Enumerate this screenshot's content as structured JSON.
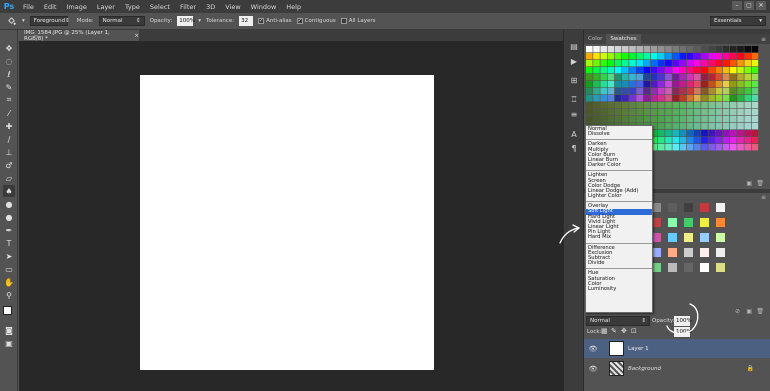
{
  "app": {
    "logo": "Ps"
  },
  "menu": [
    "File",
    "Edit",
    "Image",
    "Layer",
    "Type",
    "Select",
    "Filter",
    "3D",
    "View",
    "Window",
    "Help"
  ],
  "window_controls": [
    "–",
    "▢",
    "✕"
  ],
  "options": {
    "tool_preset_arrow": "▾",
    "fill_source": "Foreground",
    "mode_label": "Mode:",
    "mode_value": "Normal",
    "opacity_label": "Opacity:",
    "opacity_value": "100%",
    "tolerance_label": "Tolerance:",
    "tolerance_value": "32",
    "antialias_label": "Anti-alias",
    "contiguous_label": "Contiguous",
    "all_layers_label": "All Layers",
    "workspace": "Essentials"
  },
  "document": {
    "tab_title": "IMG_1584.JPG @ 25% (Layer 1, RGB/8) *",
    "close_glyph": "×"
  },
  "swatches_panel": {
    "tabs": [
      "Color",
      "Swatches"
    ]
  },
  "layers_panel": {
    "blend_mode": "Normal",
    "opacity_label": "Opacity:",
    "opacity_value": "100%",
    "lock_label": "Lock:",
    "fill_value": "100%",
    "layers": [
      {
        "name": "Layer 1",
        "selected": true
      },
      {
        "name": "Background",
        "selected": false
      }
    ]
  },
  "blend_menu": {
    "groups": [
      [
        "Normal",
        "Dissolve"
      ],
      [
        "Darken",
        "Multiply",
        "Color Burn",
        "Linear Burn",
        "Darker Color"
      ],
      [
        "Lighten",
        "Screen",
        "Color Dodge",
        "Linear Dodge (Add)",
        "Lighter Color"
      ],
      [
        "Overlay",
        "Soft Light",
        "Hard Light",
        "Vivid Light",
        "Linear Light",
        "Pin Light",
        "Hard Mix"
      ],
      [
        "Difference",
        "Exclusion",
        "Subtract",
        "Divide"
      ],
      [
        "Hue",
        "Saturation",
        "Color",
        "Luminosity"
      ]
    ],
    "selected": "Soft Light"
  },
  "colors": {
    "accent": "#31a8ff",
    "selected_layer": "#4c6082",
    "menu_highlight": "#2d6bd6"
  }
}
